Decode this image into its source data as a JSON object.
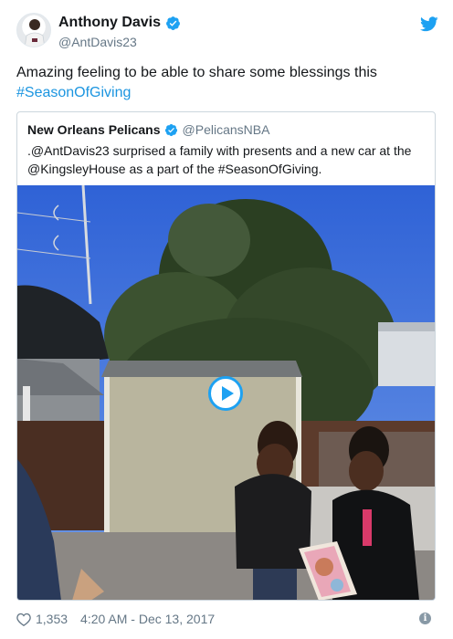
{
  "tweet": {
    "author": {
      "display_name": "Anthony Davis",
      "handle": "@AntDavis23",
      "verified": true
    },
    "text_main": "Amazing feeling to be able to share some blessings this",
    "hashtag": "#SeasonOfGiving",
    "quoted": {
      "display_name": "New Orleans Pelicans",
      "handle": "@PelicansNBA",
      "verified": true,
      "text_line1": ".@AntDavis23 surprised a family with presents and a new car at the",
      "text_line2": "@KingsleyHouse as a part of the #SeasonOfGiving."
    },
    "likes": "1,353",
    "timestamp": "4:20 AM - Dec 13, 2017"
  },
  "colors": {
    "link": "#1b95e0",
    "twitter_blue": "#1da1f2",
    "meta_gray": "#657786"
  },
  "icons": {
    "brand": "twitter-bird-icon",
    "verified": "verified-badge-icon",
    "play": "play-icon",
    "like": "heart-icon",
    "info": "info-icon"
  }
}
